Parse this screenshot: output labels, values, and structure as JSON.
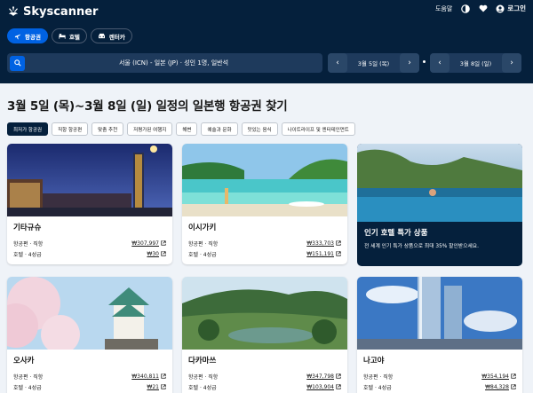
{
  "header": {
    "brand": "Skyscanner",
    "help": "도움말",
    "login": "로그인"
  },
  "tabs": [
    {
      "label": "항공권",
      "icon": "plane-icon",
      "active": true
    },
    {
      "label": "호텔",
      "icon": "bed-icon",
      "active": false
    },
    {
      "label": "렌터카",
      "icon": "car-icon",
      "active": false
    }
  ],
  "search": {
    "summary": "서울 (ICN) - 일본 (JP) · 성인 1명, 일반석",
    "depart_date": "3월 5일 (목)",
    "return_date": "3월 8일 (일)"
  },
  "main": {
    "title": "3월 5일 (목)~3월 8일 (일) 일정의 일본행 항공권 찾기"
  },
  "filters": [
    "최저가 항공권",
    "직항 항공편",
    "맞춤 추천",
    "저평가된 여행지",
    "해변",
    "예술과 문화",
    "맛있는 음식",
    "나이트라이프 및 엔터테인먼트"
  ],
  "labels": {
    "flight": "항공편 · 직항",
    "hotel": "호텔 · 4성급"
  },
  "cards": [
    {
      "city": "기타규슈",
      "flight_price": "₩307,997",
      "hotel_price": "₩30"
    },
    {
      "city": "이시가키",
      "flight_price": "₩333,703",
      "hotel_price": "₩151,191"
    },
    {
      "city": "오사카",
      "flight_price": "₩340,811",
      "hotel_price": "₩21"
    },
    {
      "city": "다카마쓰",
      "flight_price": "₩347,798",
      "hotel_price": "₩103,904"
    },
    {
      "city": "나고야",
      "flight_price": "₩354,194",
      "hotel_price": "₩84,328"
    }
  ],
  "promo": {
    "title": "인기 호텔 특가 상품",
    "subtitle": "전 세계 인기 특가 상품으로 최대 35% 할인받으세요."
  },
  "colors": {
    "navy": "#05203c",
    "accent": "#0062e3"
  }
}
